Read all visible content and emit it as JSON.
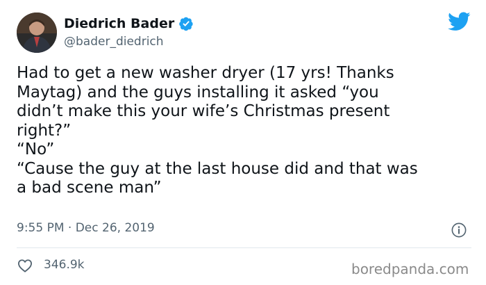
{
  "colors": {
    "twitter_blue": "#1DA1F2",
    "text_primary": "#0f1419",
    "text_secondary": "#536471",
    "divider": "#e1e8ed"
  },
  "author": {
    "display_name": "Diedrich Bader",
    "handle": "@bader_diedrich",
    "verified": true,
    "avatar_icon": "profile-photo"
  },
  "tweet": {
    "lines": [
      "Had to get a new washer dryer (17 yrs! Thanks",
      "Maytag) and the guys installing it asked “you",
      "didn’t make this your wife’s Christmas present",
      "right?”",
      "“No”",
      "“Cause the guy at the last house did and that was",
      "a bad scene man”"
    ]
  },
  "meta": {
    "timestamp": "9:55 PM · Dec 26, 2019"
  },
  "actions": {
    "like_count": "346.9k"
  },
  "watermark": "boredpanda.com",
  "icons": {
    "brand": "twitter-bird-icon",
    "verified": "verified-badge-icon",
    "info": "info-icon",
    "like": "heart-icon"
  }
}
